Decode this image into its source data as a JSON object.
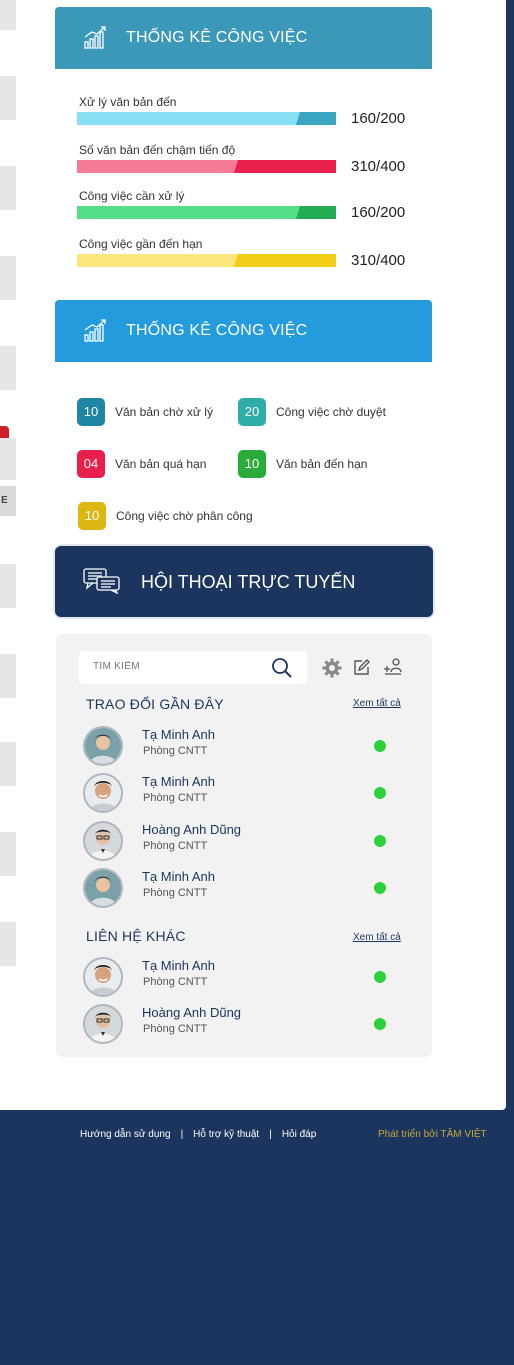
{
  "stats_card": {
    "title": "THỐNG KÊ CÔNG VIỆC",
    "header_color": "#3b98b8",
    "items": [
      {
        "label": "Xử lý văn bản đến",
        "value": "160/200",
        "fraction": 0.8,
        "light": "#86dff3",
        "dark": "#3aa6c1"
      },
      {
        "label": "Số văn bản đến chậm tiến độ",
        "value": "310/400",
        "fraction": 0.6,
        "light": "#f47b93",
        "dark": "#ea1f4b"
      },
      {
        "label": "Công việc cần xử lý",
        "value": "160/200",
        "fraction": 0.8,
        "light": "#55de87",
        "dark": "#24ac53"
      },
      {
        "label": "Công việc gần đến hạn",
        "value": "310/400",
        "fraction": 0.6,
        "light": "#fbe67b",
        "dark": "#f3cd15"
      }
    ]
  },
  "counts_card": {
    "title": "THỐNG KÊ CÔNG VIỆC",
    "header_color": "#239bdc",
    "items": [
      {
        "count": "10",
        "label": "Văn bản chờ xử lý",
        "color": "#1e85a4"
      },
      {
        "count": "20",
        "label": "Công việc chờ duyệt",
        "color": "#2eaea8"
      },
      {
        "count": "04",
        "label": "Văn bản quá hạn",
        "color": "#ea1f4b"
      },
      {
        "count": "10",
        "label": "Văn bản đến hạn",
        "color": "#2aac3b"
      },
      {
        "count": "10",
        "label": "Công việc chờ phân công",
        "color": "#dcb712"
      }
    ]
  },
  "chat": {
    "title": "HỘI THOẠI TRỰC TUYẾN",
    "search_placeholder": "TÌM KIẾM",
    "recent": {
      "title": "TRAO ĐỔI GẦN ĐÂY",
      "see_all": "Xem tất cả",
      "contacts": [
        {
          "name": "Tạ Minh Anh",
          "dept": "Phòng CNTT",
          "online": true
        },
        {
          "name": "Tạ Minh Anh",
          "dept": "Phòng CNTT",
          "online": true
        },
        {
          "name": "Hoàng Anh Dũng",
          "dept": "Phòng CNTT",
          "online": true
        },
        {
          "name": "Tạ Minh Anh",
          "dept": "Phòng CNTT",
          "online": true
        }
      ]
    },
    "others": {
      "title": "LIÊN HỆ KHÁC",
      "see_all": "Xem tất cả",
      "contacts": [
        {
          "name": "Tạ Minh Anh",
          "dept": "Phòng CNTT",
          "online": true
        },
        {
          "name": "Hoàng Anh Dũng",
          "dept": "Phòng CNTT",
          "online": true
        }
      ]
    },
    "online_color": "#2dd23a"
  },
  "left_strip": {
    "letter": "E"
  },
  "footer": {
    "links": [
      "Hướng dẫn sử dụng",
      "Hỗ trợ kỹ thuật",
      "Hỏi đáp"
    ],
    "separator": "|",
    "credit": "Phát triển bởi TÂM VIỆT",
    "credit_color": "#c7a83a"
  }
}
